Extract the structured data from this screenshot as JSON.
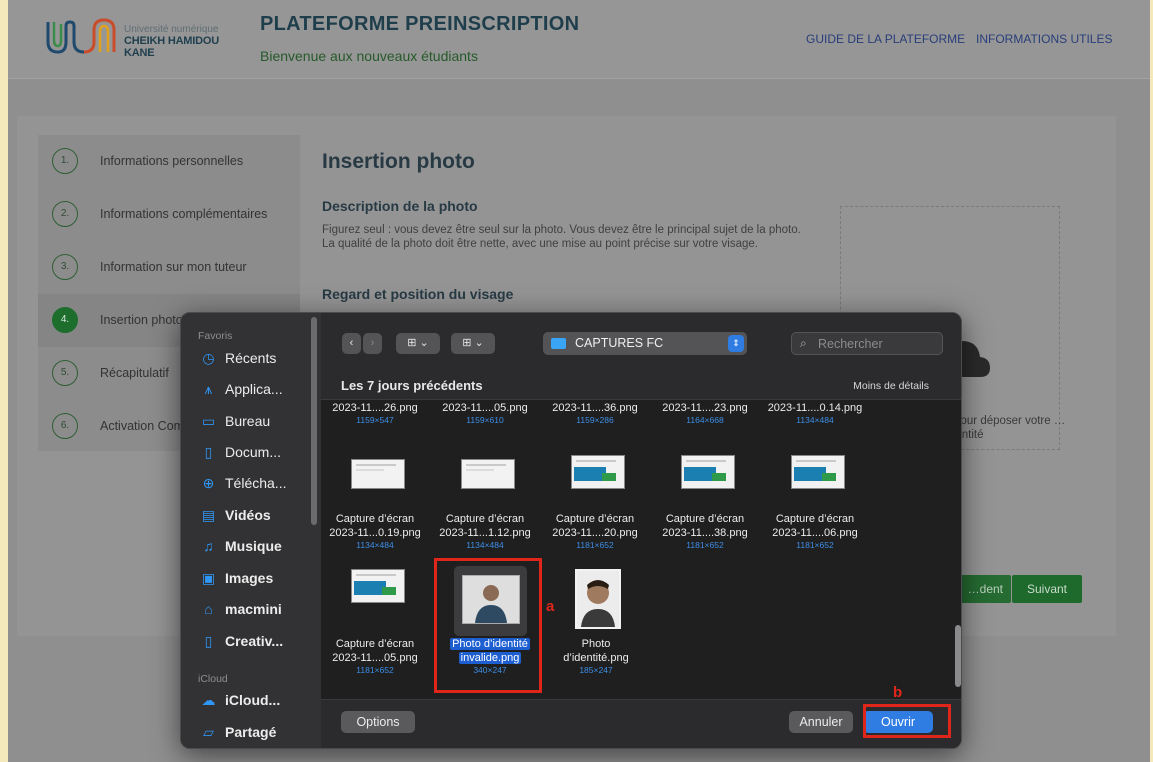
{
  "header": {
    "logo_line1": "Université numérique",
    "logo_line2": "CHEIKH HAMIDOU KANE",
    "title": "PLATEFORME PREINSCRIPTION",
    "subtitle": "Bienvenue aux nouveaux étudiants",
    "nav": [
      "GUIDE DE LA PLATEFORME",
      "INFORMATIONS UTILES"
    ]
  },
  "steps": [
    {
      "num": "1.",
      "label": "Informations personnelles"
    },
    {
      "num": "2.",
      "label": "Informations complémentaires"
    },
    {
      "num": "3.",
      "label": "Information sur mon tuteur"
    },
    {
      "num": "4.",
      "label": "Insertion photo"
    },
    {
      "num": "5.",
      "label": "Récapitulatif"
    },
    {
      "num": "6.",
      "label": "Activation Compte"
    }
  ],
  "content": {
    "section_title": "Insertion photo",
    "desc_heading": "Description de la photo",
    "desc_text": "Figurez seul : vous devez être seul sur la photo. Vous devez être le principal sujet de la photo. La qualité de la photo doit être nette, avec une mise au point précise sur votre visage.",
    "regard_heading": "Regard et position du visage",
    "drop_text": "…our déposer votre …dentité",
    "prev_label": "…dent",
    "next_label": "Suivant"
  },
  "dialog": {
    "sidebar": {
      "favorites_title": "Favoris",
      "favorites": [
        {
          "label": "Récents",
          "icon": "clock-icon"
        },
        {
          "label": "Applica...",
          "icon": "applications-icon"
        },
        {
          "label": "Bureau",
          "icon": "desktop-icon"
        },
        {
          "label": "Docum...",
          "icon": "document-icon"
        },
        {
          "label": "Télécha...",
          "icon": "download-icon"
        },
        {
          "label": "Vidéos",
          "icon": "film-icon"
        },
        {
          "label": "Musique",
          "icon": "music-icon"
        },
        {
          "label": "Images",
          "icon": "image-icon"
        },
        {
          "label": "macmini",
          "icon": "home-icon"
        },
        {
          "label": "Creativ...",
          "icon": "file-icon"
        }
      ],
      "icloud_title": "iCloud",
      "icloud": [
        {
          "label": "iCloud...",
          "icon": "cloud-icon"
        },
        {
          "label": "Partagé",
          "icon": "shared-folder-icon"
        }
      ]
    },
    "toolbar": {
      "back": "‹",
      "forward": "›",
      "view_icons": "⊞",
      "view_group": "⊞",
      "folder": "CAPTURES FC",
      "search_placeholder": "Rechercher"
    },
    "group_title": "Les 7 jours précédents",
    "less_details": "Moins de détails",
    "top_row": [
      {
        "name": "2023-11....26.png",
        "dims": "1159×547"
      },
      {
        "name": "2023-11....05.png",
        "dims": "1159×610"
      },
      {
        "name": "2023-11....36.png",
        "dims": "1159×286"
      },
      {
        "name": "2023-11....23.png",
        "dims": "1164×668"
      },
      {
        "name": "2023-11....0.14.png",
        "dims": "1134×484"
      }
    ],
    "mid_row": [
      {
        "line1": "Capture d’écran",
        "line2": "2023-11...0.19.png",
        "dims": "1134×484"
      },
      {
        "line1": "Capture d’écran",
        "line2": "2023-11...1.12.png",
        "dims": "1134×484"
      },
      {
        "line1": "Capture d’écran",
        "line2": "2023-11....20.png",
        "dims": "1181×652"
      },
      {
        "line1": "Capture d’écran",
        "line2": "2023-11....38.png",
        "dims": "1181×652"
      },
      {
        "line1": "Capture d’écran",
        "line2": "2023-11....06.png",
        "dims": "1181×652"
      }
    ],
    "bottom_row": [
      {
        "line1": "Capture d’écran",
        "line2": "2023-11....05.png",
        "dims": "1181×652"
      },
      {
        "line1": "Photo d’identité",
        "line2": "invalide.png",
        "dims": "340×247"
      },
      {
        "line1": "Photo",
        "line2": "d’identité.png",
        "dims": "185×247"
      }
    ],
    "options_label": "Options",
    "cancel_label": "Annuler",
    "open_label": "Ouvrir"
  },
  "annotations": {
    "a": "a",
    "b": "b"
  },
  "colors": {
    "accent_green": "#1d6e2c",
    "mac_blue": "#2f7de3",
    "annotation_red": "#e0261b"
  }
}
